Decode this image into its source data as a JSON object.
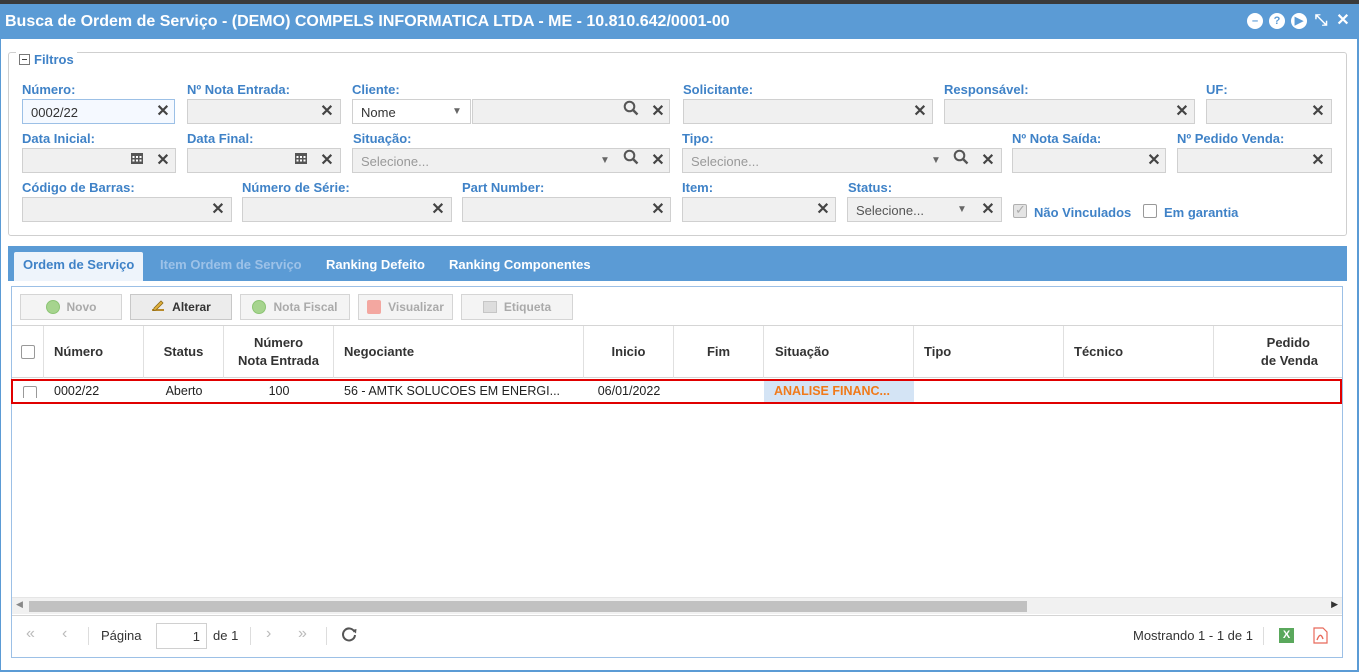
{
  "title": "Busca de Ordem de Serviço - (DEMO) COMPELS INFORMATICA LTDA - ME - 10.810.642/0001-00",
  "filters": {
    "legend": "Filtros",
    "numero": {
      "label": "Número:",
      "value": "0002/22"
    },
    "nota_entrada": {
      "label": "Nº Nota Entrada:",
      "value": ""
    },
    "cliente": {
      "label": "Cliente:",
      "type_value": "Nome",
      "value": ""
    },
    "solicitante": {
      "label": "Solicitante:",
      "value": ""
    },
    "responsavel": {
      "label": "Responsável:",
      "value": ""
    },
    "uf": {
      "label": "UF:",
      "value": ""
    },
    "data_inicial": {
      "label": "Data Inicial:",
      "value": ""
    },
    "data_final": {
      "label": "Data Final:",
      "value": ""
    },
    "situacao": {
      "label": "Situação:",
      "placeholder": "Selecione..."
    },
    "tipo": {
      "label": "Tipo:",
      "placeholder": "Selecione..."
    },
    "nota_saida": {
      "label": "Nº Nota Saída:",
      "value": ""
    },
    "pedido_venda": {
      "label": "Nº Pedido Venda:",
      "value": ""
    },
    "codigo_barras": {
      "label": "Código de Barras:",
      "value": ""
    },
    "numero_serie": {
      "label": "Número de Série:",
      "value": ""
    },
    "part_number": {
      "label": "Part Number:",
      "value": ""
    },
    "item": {
      "label": "Item:",
      "value": ""
    },
    "status": {
      "label": "Status:",
      "placeholder": "Selecione..."
    },
    "nao_vinculados": {
      "label": "Não Vinculados",
      "checked": true
    },
    "em_garantia": {
      "label": "Em garantia",
      "checked": false
    }
  },
  "tabs": [
    {
      "label": "Ordem de Serviço",
      "state": "active"
    },
    {
      "label": "Item Ordem de Serviço",
      "state": "disabled"
    },
    {
      "label": "Ranking Defeito",
      "state": "normal"
    },
    {
      "label": "Ranking Componentes",
      "state": "normal"
    }
  ],
  "toolbar": {
    "novo": "Novo",
    "alterar": "Alterar",
    "nota_fiscal": "Nota Fiscal",
    "visualizar": "Visualizar",
    "etiqueta": "Etiqueta"
  },
  "grid": {
    "columns": {
      "numero": "Número",
      "status": "Status",
      "nota_entrada_1": "Número",
      "nota_entrada_2": "Nota Entrada",
      "negociante": "Negociante",
      "inicio": "Inicio",
      "fim": "Fim",
      "situacao": "Situação",
      "tipo": "Tipo",
      "tecnico": "Técnico",
      "pedido_1": "Pedido",
      "pedido_2": "de Venda"
    },
    "rows": [
      {
        "numero": "0002/22",
        "status": "Aberto",
        "nota_entrada": "100",
        "negociante": "56 - AMTK SOLUCOES EM ENERGI...",
        "inicio": "06/01/2022",
        "fim": "",
        "situacao": "ANALISE FINANC...",
        "tipo": "",
        "tecnico": "",
        "pedido": ""
      }
    ]
  },
  "pager": {
    "page_label": "Página",
    "page": "1",
    "of_label": "de 1",
    "showing": "Mostrando 1 - 1 de 1"
  },
  "colors": {
    "accent": "#5b9bd5",
    "label": "#3f82c7",
    "situacao_text": "#f07a1a",
    "situacao_bg": "#d4e4f5",
    "highlight_border": "#e00000"
  }
}
